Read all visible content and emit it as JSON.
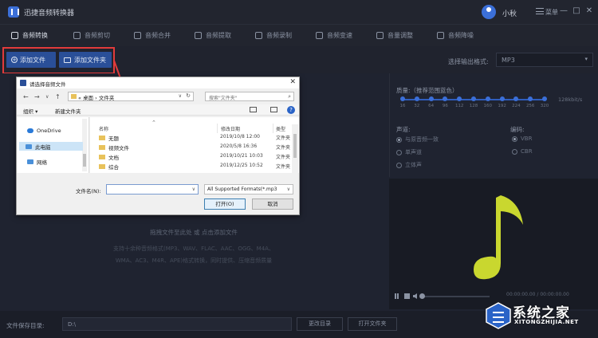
{
  "app": {
    "title": "迅捷音频转换器",
    "username": "小秋",
    "menu_label": "菜单",
    "window_controls": [
      "—",
      "□",
      "✕"
    ]
  },
  "nav": {
    "tabs": [
      {
        "label": "音频转换",
        "active": true
      },
      {
        "label": "音频剪切",
        "active": false
      },
      {
        "label": "音频合并",
        "active": false
      },
      {
        "label": "音频提取",
        "active": false
      },
      {
        "label": "音频录制",
        "active": false
      },
      {
        "label": "音频变速",
        "active": false
      },
      {
        "label": "音量调整",
        "active": false
      },
      {
        "label": "音频降噪",
        "active": false
      }
    ]
  },
  "toolbar": {
    "add_file": "添加文件",
    "add_folder": "添加文件夹",
    "format_label": "选择输出格式:",
    "format_value": "MP3"
  },
  "drop": {
    "main": "拖拽文件至此处 或 点击添加文件",
    "sub_line1": "支持十余种音频格式(MP3、WAV、FLAC、AAC、OGG、M4A、",
    "sub_line2": "WMA、AC3、M4R、APE)格式转换，同时提供、压缩音频质量"
  },
  "settings": {
    "quality_label": "质量:（推荐范围蓝色）",
    "ticks": [
      "16",
      "32",
      "64",
      "96",
      "112",
      "128",
      "160",
      "192",
      "224",
      "256",
      "320"
    ],
    "unit": "128kbit/s",
    "channel_label": "声道:",
    "channel_options": [
      "与原音频一致",
      "单声道",
      "立体声"
    ],
    "encoding_label": "编码:",
    "encoding_options": [
      "VBR",
      "CBR"
    ]
  },
  "player": {
    "time": "00:00:00.00 / 00:00:00.00"
  },
  "bottom": {
    "save_label": "文件保存目录:",
    "save_path": "D:\\",
    "change_dir": "更改目录",
    "open_folder": "打开文件夹"
  },
  "dialog": {
    "title": "请选择音频文件",
    "address_parts": [
      "«",
      "桌面",
      "›",
      "文件夹"
    ],
    "search_placeholder": "搜索\"文件夹\"",
    "organize": "组织 ▾",
    "new_folder": "新建文件夹",
    "left_items": [
      "OneDrive",
      "此电脑",
      "网络"
    ],
    "columns": [
      "名称",
      "修改日期",
      "类型"
    ],
    "files": [
      {
        "name": "无题",
        "date": "2019/10/8 12:00",
        "type": "文件夹"
      },
      {
        "name": "视频文件",
        "date": "2020/5/8 16:36",
        "type": "文件夹"
      },
      {
        "name": "文档",
        "date": "2019/10/21 10:03",
        "type": "文件夹"
      },
      {
        "name": "综合",
        "date": "2019/12/25 10:52",
        "type": "文件夹"
      }
    ],
    "filename_label": "文件名(N):",
    "filter": "All Supported Formats(*.mp3",
    "open_btn": "打开(O)",
    "cancel_btn": "取消"
  },
  "watermark": {
    "text": "系统之家",
    "url": "XITONGZHIJIA.NET"
  },
  "colors": {
    "accent": "#2a4f98",
    "highlight": "#e23b3b",
    "note": "#c9d72f"
  }
}
